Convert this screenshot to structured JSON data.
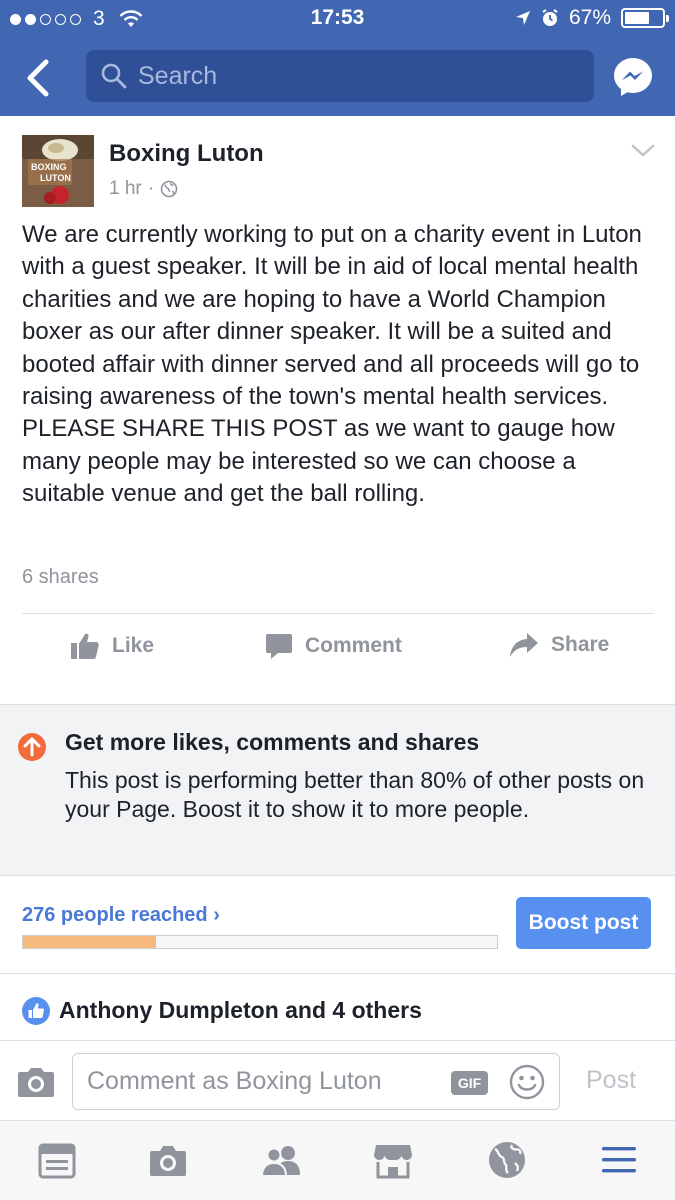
{
  "status_bar": {
    "carrier": "3",
    "time": "17:53",
    "battery_text": "67%",
    "battery_level": 0.67,
    "signal_bars_filled": 2,
    "signal_bars_total": 5
  },
  "nav": {
    "search_placeholder": "Search",
    "back_icon": "chevron-left-icon",
    "messenger_icon": "messenger-icon"
  },
  "post": {
    "page_name": "Boxing Luton",
    "avatar_text": [
      "BOXING",
      "LUTON"
    ],
    "timestamp": "1 hr",
    "audience_icon": "globe-icon",
    "body": "We are currently working to put on a charity event in Luton with a guest speaker. It will be in aid of local mental health charities and we are hoping to have a World Champion boxer as our after dinner speaker. It will be a suited and booted affair with dinner served and all proceeds will go to raising awareness of the town's mental health services. PLEASE SHARE THIS POST  as we want to gauge how many people may be interested so we can choose a suitable venue and get the ball rolling.",
    "shares": "6 shares",
    "actions": {
      "like": "Like",
      "comment": "Comment",
      "share": "Share"
    }
  },
  "boost_banner": {
    "title": "Get more likes, comments and shares",
    "description": "This post is performing better than 80% of other posts on your Page. Boost it to show it to more people."
  },
  "reach": {
    "text": "276 people reached ›",
    "progress_fraction": 0.28,
    "boost_button": "Boost post"
  },
  "reactions": {
    "text": "Anthony Dumpleton and 4 others"
  },
  "composer": {
    "placeholder": "Comment as Boxing Luton",
    "gif_label": "GIF",
    "post_label": "Post"
  },
  "tabs": [
    "news-feed-icon",
    "camera-icon",
    "friends-icon",
    "marketplace-icon",
    "globe-icon",
    "menu-icon"
  ],
  "colors": {
    "brand_blue": "#4267b2",
    "boost_blue": "#5890f0",
    "link_blue": "#4a78d6",
    "progress_orange": "#f7b97c",
    "up_arrow_orange": "#f26b3a"
  }
}
